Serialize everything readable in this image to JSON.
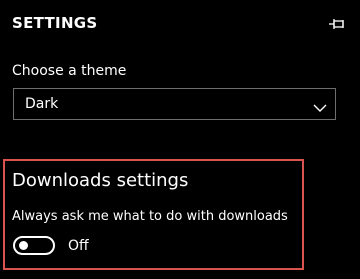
{
  "header": {
    "title": "SETTINGS",
    "pin_icon": "pin-icon"
  },
  "theme": {
    "label": "Choose a theme",
    "selected": "Dark",
    "dropdown_icon": "chevron-down-icon"
  },
  "downloads": {
    "heading": "Downloads settings",
    "ask_label": "Always ask me what to do with downloads",
    "toggle_state": "Off",
    "toggle_on": false
  },
  "colors": {
    "background": "#000000",
    "text": "#ffffff",
    "highlight_border": "#d9534f",
    "select_border": "#6e6e6e"
  }
}
